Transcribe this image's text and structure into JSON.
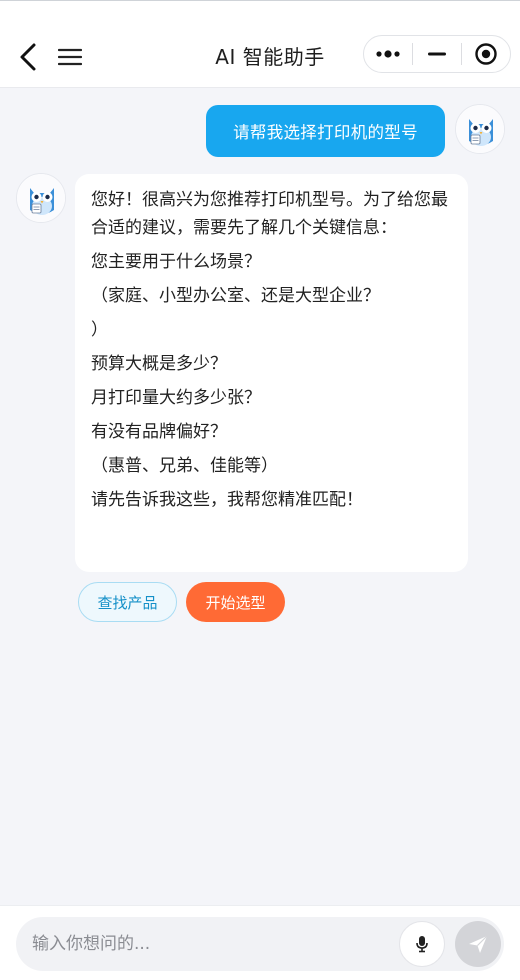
{
  "header": {
    "title": "AI 智能助手",
    "back_icon": "chevron-left-icon",
    "menu_icon": "hamburger-menu-icon",
    "capsule_icons": [
      "more-dots-icon",
      "minimize-icon",
      "close-target-icon"
    ]
  },
  "chat": {
    "user_message": "请帮我选择打印机的型号",
    "ai_message": {
      "lines": [
        "您好！很高兴为您推荐打印机型号。为了给您最合适的建议，需要先了解几个关键信息：",
        "您主要用于什么场景？",
        "（家庭、小型办公室、还是大型企业？",
        "）",
        "预算大概是多少？",
        "月打印量大约多少张？",
        "有没有品牌偏好？",
        "（惠普、兄弟、佳能等）",
        "请先告诉我这些，我帮您精准匹配！"
      ]
    },
    "quick_replies": {
      "find_label": "查找产品",
      "start_label": "开始选型"
    }
  },
  "composer": {
    "placeholder": "输入你想问的...",
    "value": "",
    "mic_icon": "microphone-icon",
    "send_icon": "send-paper-plane-icon"
  },
  "colors": {
    "user_bubble": "#18a7ef",
    "primary_chip": "#ff6a35",
    "secondary_chip_text": "#1590c8",
    "page_bg": "#f4f5f9"
  }
}
